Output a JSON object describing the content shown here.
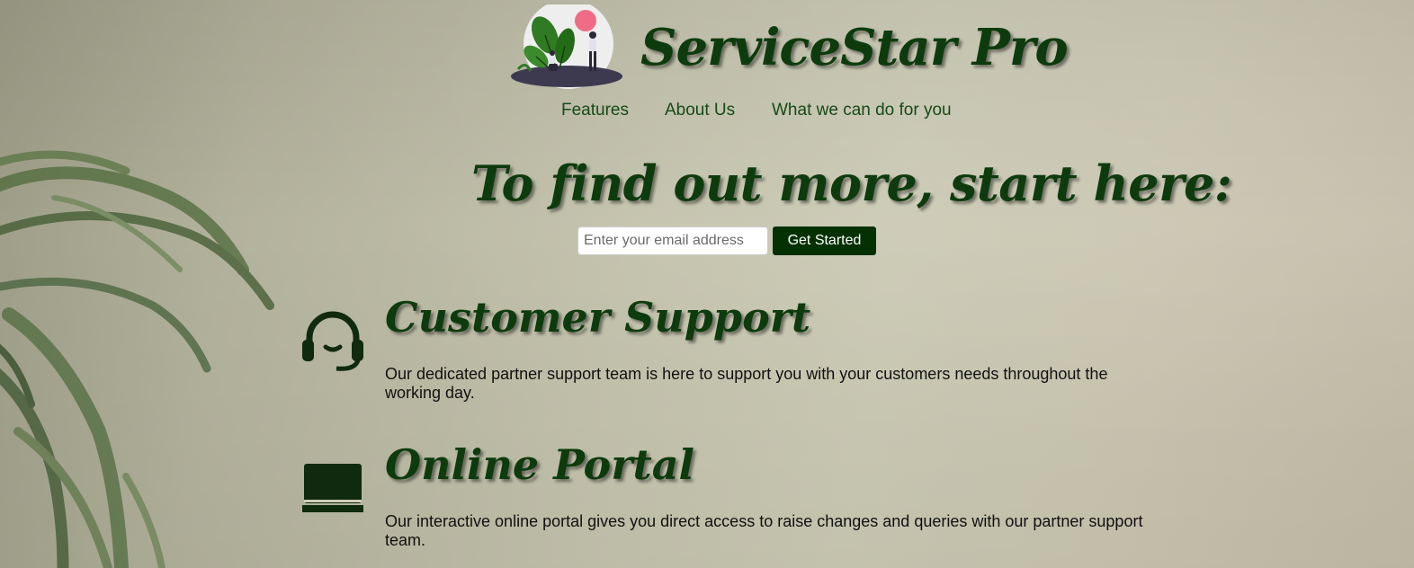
{
  "brand": {
    "name": "ServiceStar Pro",
    "logo_icon": "people-with-plants-illustration-icon"
  },
  "nav": {
    "items": [
      {
        "label": "Features"
      },
      {
        "label": "About Us"
      },
      {
        "label": "What we can do for you"
      }
    ]
  },
  "hero": {
    "title": "To find out more, start here:"
  },
  "signup": {
    "email_placeholder": "Enter your email address",
    "email_value": "",
    "submit_label": "Get Started"
  },
  "features": [
    {
      "icon": "headset-icon",
      "title": "Customer Support",
      "description": "Our dedicated partner support team is here to support you with your customers needs throughout the working day."
    },
    {
      "icon": "laptop-icon",
      "title": "Online Portal",
      "description": "Our interactive online portal gives you direct access to raise changes and queries with our partner support team."
    }
  ],
  "colors": {
    "accent_green": "#0d3b0d",
    "button_bg": "#043104",
    "background": "#c4c3ad"
  }
}
